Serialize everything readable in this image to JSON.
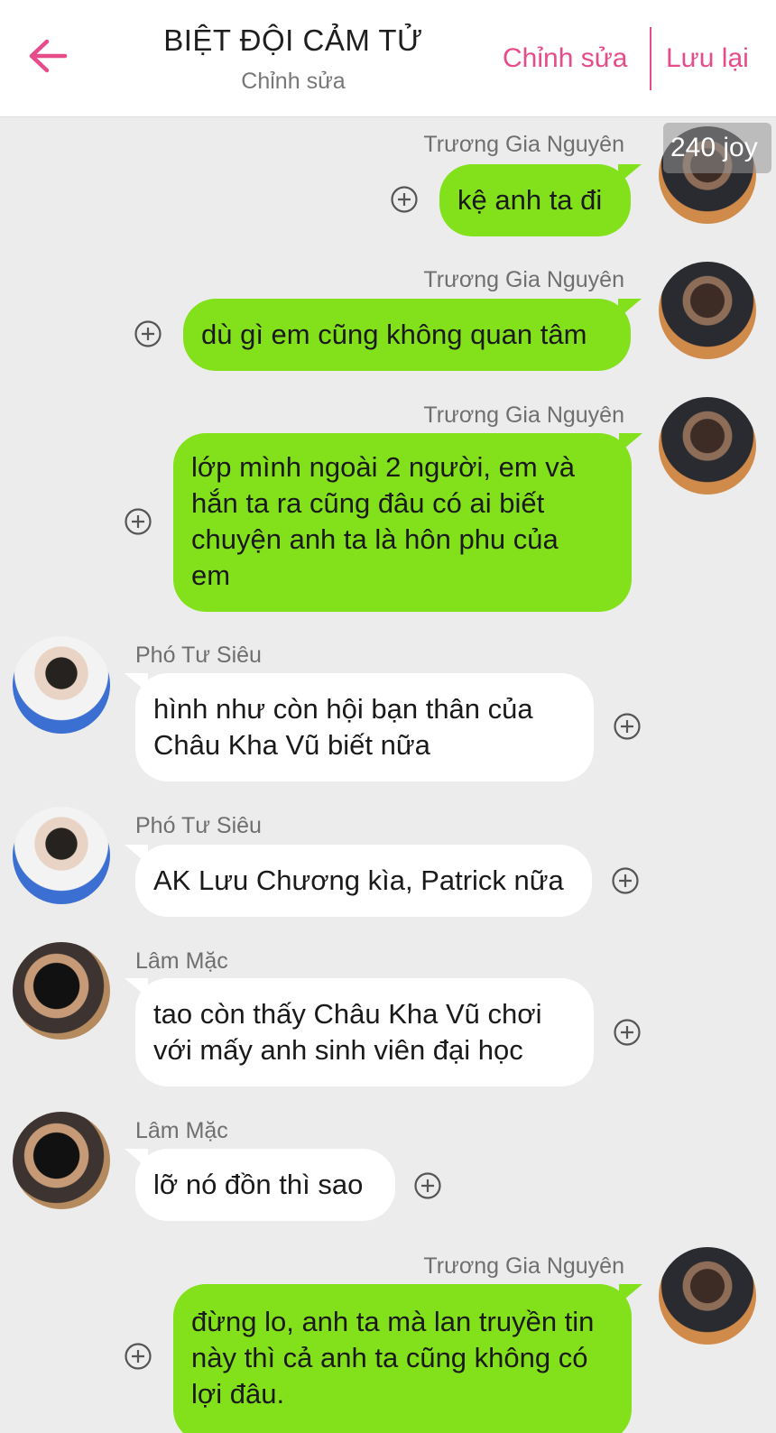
{
  "header": {
    "title": "BIỆT ĐỘI CẢM TỬ",
    "subtitle": "Chỉnh sửa",
    "edit_label": "Chỉnh sửa",
    "save_label": "Lưu lại",
    "accent_color": "#e64c8a"
  },
  "badge": {
    "text": "240 joy"
  },
  "icons": {
    "back": "arrow-left-icon",
    "add": "plus-circle-icon"
  },
  "colors": {
    "my_bubble": "#83e11c",
    "other_bubble": "#ffffff",
    "background": "#ececec"
  },
  "messages": [
    {
      "sender": "Trương Gia Nguyên",
      "side": "right",
      "text": "kệ anh ta đi"
    },
    {
      "sender": "Trương Gia Nguyên",
      "side": "right",
      "text": "dù gì em cũng không quan tâm"
    },
    {
      "sender": "Trương Gia Nguyên",
      "side": "right",
      "lines": [
        "lớp mình ngoài 2 người, em và",
        "hắn ta ra cũng đâu có ai biết",
        "chuyện anh ta là hôn phu của",
        "em"
      ]
    },
    {
      "sender": "Phó Tư Siêu",
      "side": "left",
      "lines": [
        "hình như còn hội bạn thân của",
        "Châu Kha Vũ biết nữa"
      ]
    },
    {
      "sender": "Phó Tư Siêu",
      "side": "left",
      "text": "AK Lưu Chương kìa, Patrick nữa"
    },
    {
      "sender": "Lâm Mặc",
      "side": "left",
      "lines": [
        "tao còn thấy Châu Kha Vũ chơi",
        "với mấy anh sinh viên đại học"
      ]
    },
    {
      "sender": "Lâm Mặc",
      "side": "left",
      "text": "lỡ nó đồn thì sao"
    },
    {
      "sender": "Trương Gia Nguyên",
      "side": "right",
      "lines": [
        "đừng lo, anh ta mà lan truyền tin",
        "này thì cả anh ta cũng không có",
        "lợi đâu."
      ]
    }
  ]
}
